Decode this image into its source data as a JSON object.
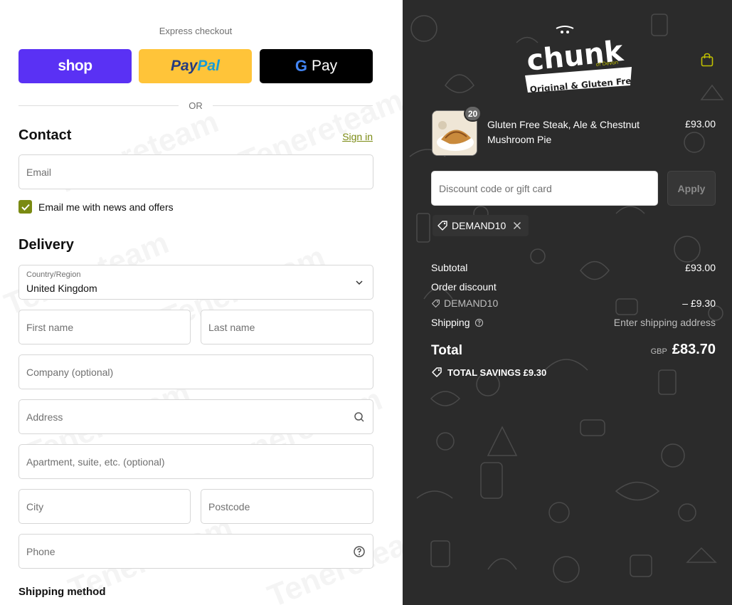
{
  "express": {
    "title": "Express checkout",
    "shop_label": "shop",
    "paypal_label_a": "Pay",
    "paypal_label_b": "Pal",
    "gpay_g": "G",
    "gpay_label": "Pay",
    "or_label": "OR"
  },
  "contact": {
    "title": "Contact",
    "sign_in": "Sign in",
    "email_placeholder": "Email",
    "newsletter_label": "Email me with news and offers",
    "newsletter_checked": true
  },
  "delivery": {
    "title": "Delivery",
    "country_label": "Country/Region",
    "country_value": "United Kingdom",
    "first_name_placeholder": "First name",
    "last_name_placeholder": "Last name",
    "company_placeholder": "Company (optional)",
    "address_placeholder": "Address",
    "apartment_placeholder": "Apartment, suite, etc. (optional)",
    "city_placeholder": "City",
    "postcode_placeholder": "Postcode",
    "phone_placeholder": "Phone"
  },
  "shipping_method": {
    "title": "Shipping method"
  },
  "watermark": "Tenereteam",
  "order": {
    "logo_text": "chunk",
    "logo_sub": "of Devon",
    "logo_tagline": "Original & Gluten Free",
    "item": {
      "quantity": "20",
      "name": "Gluten Free Steak, Ale & Chestnut Mushroom Pie",
      "price": "£93.00"
    },
    "discount_placeholder": "Discount code or gift card",
    "apply_label": "Apply",
    "applied_code": "DEMAND10",
    "subtotal_label": "Subtotal",
    "subtotal_value": "£93.00",
    "order_discount_label": "Order discount",
    "discount_code": "DEMAND10",
    "discount_value": "– £9.30",
    "shipping_label": "Shipping",
    "shipping_value": "Enter shipping address",
    "total_label": "Total",
    "total_currency": "GBP",
    "total_value": "£83.70",
    "savings_label": "TOTAL SAVINGS £9.30"
  },
  "colors": {
    "accent": "#7a8a12",
    "shop_pay": "#5a31f4",
    "paypal": "#ffc439",
    "summary_bg": "#2b2b2b"
  }
}
